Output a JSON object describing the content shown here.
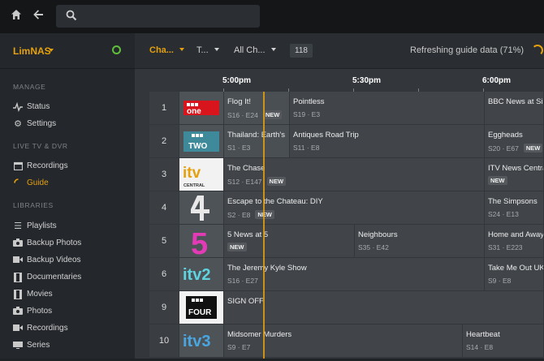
{
  "colors": {
    "accent": "#e5a00d",
    "online": "#5fbf3a"
  },
  "topbar": {
    "home_icon": "home-icon",
    "back_icon": "back-arrow-icon",
    "search_icon": "search-icon",
    "search_placeholder": ""
  },
  "sidebar": {
    "server_name": "LimNAS",
    "sections": [
      {
        "title": "MANAGE",
        "items": [
          {
            "label": "Status",
            "icon": "activity-icon"
          },
          {
            "label": "Settings",
            "icon": "gear-icon"
          }
        ]
      },
      {
        "title": "LIVE TV & DVR",
        "items": [
          {
            "label": "Recordings",
            "icon": "calendar-icon"
          },
          {
            "label": "Guide",
            "icon": "guide-icon",
            "active": true
          }
        ]
      },
      {
        "title": "LIBRARIES",
        "items": [
          {
            "label": "Playlists",
            "icon": "list-icon"
          },
          {
            "label": "Backup Photos",
            "icon": "camera-icon"
          },
          {
            "label": "Backup Videos",
            "icon": "video-icon"
          },
          {
            "label": "Documentaries",
            "icon": "film-icon"
          },
          {
            "label": "Movies",
            "icon": "film-icon"
          },
          {
            "label": "Photos",
            "icon": "camera-icon"
          },
          {
            "label": "Recordings",
            "icon": "video-icon"
          },
          {
            "label": "Series",
            "icon": "tv-icon"
          }
        ]
      }
    ]
  },
  "toolbar": {
    "filter1": "Cha...",
    "filter2": "T...",
    "filter3": "All Ch...",
    "channel_count": "118",
    "refresh_status": "Refreshing guide data (71%)"
  },
  "timeline": {
    "times": [
      "5:00pm",
      "5:30pm",
      "6:00pm"
    ]
  },
  "guide": {
    "rows": [
      {
        "number": "1",
        "logo": "BBC one",
        "programs": [
          {
            "title": "Flog It!",
            "sub": "S16 · E24",
            "badge": "NEW",
            "past": true
          },
          {
            "title": "Pointless",
            "sub": "S19 · E3",
            "badge": ""
          },
          {
            "title": "BBC News at Six",
            "sub": "",
            "badge": ""
          }
        ]
      },
      {
        "number": "2",
        "logo": "BBC TWO",
        "programs": [
          {
            "title": "Thailand: Earth's",
            "sub": "S1 · E3",
            "badge": "",
            "past": true
          },
          {
            "title": "Antiques Road Trip",
            "sub": "S11 · E8",
            "badge": ""
          },
          {
            "title": "Eggheads",
            "sub": "S20 · E67",
            "badge": "NEW"
          }
        ]
      },
      {
        "number": "3",
        "logo": "itv CENTRAL",
        "programs": [
          {
            "title": "The Chase",
            "sub": "S12 · E147",
            "badge": "NEW"
          },
          {
            "title": "ITV News Central",
            "sub": "",
            "badge": "NEW",
            "badge_only": true
          }
        ]
      },
      {
        "number": "4",
        "logo": "4",
        "programs": [
          {
            "title": "Escape to the Chateau: DIY",
            "sub": "S2 · E8",
            "badge": "NEW"
          },
          {
            "title": "The Simpsons",
            "sub": "S24 · E13",
            "badge": ""
          }
        ]
      },
      {
        "number": "5",
        "logo": "5",
        "programs": [
          {
            "title": "5 News at 5",
            "sub": "",
            "badge": "NEW",
            "badge_only": true
          },
          {
            "title": "Neighbours",
            "sub": "S35 · E42",
            "badge": ""
          },
          {
            "title": "Home and Away",
            "sub": "S31 · E223",
            "badge": ""
          }
        ]
      },
      {
        "number": "6",
        "logo": "itv2",
        "programs": [
          {
            "title": "The Jeremy Kyle Show",
            "sub": "S16 · E27",
            "badge": ""
          },
          {
            "title": "Take Me Out UK",
            "sub": "S9 · E8",
            "badge": ""
          }
        ]
      },
      {
        "number": "9",
        "logo": "BBC FOUR",
        "programs": [
          {
            "title": "SIGN OFF",
            "sub": "",
            "badge": ""
          }
        ]
      },
      {
        "number": "10",
        "logo": "itv3",
        "programs": [
          {
            "title": "Midsomer Murders",
            "sub": "S9 · E7",
            "badge": ""
          },
          {
            "title": "Heartbeat",
            "sub": "S14 · E8",
            "badge": ""
          }
        ]
      }
    ]
  }
}
